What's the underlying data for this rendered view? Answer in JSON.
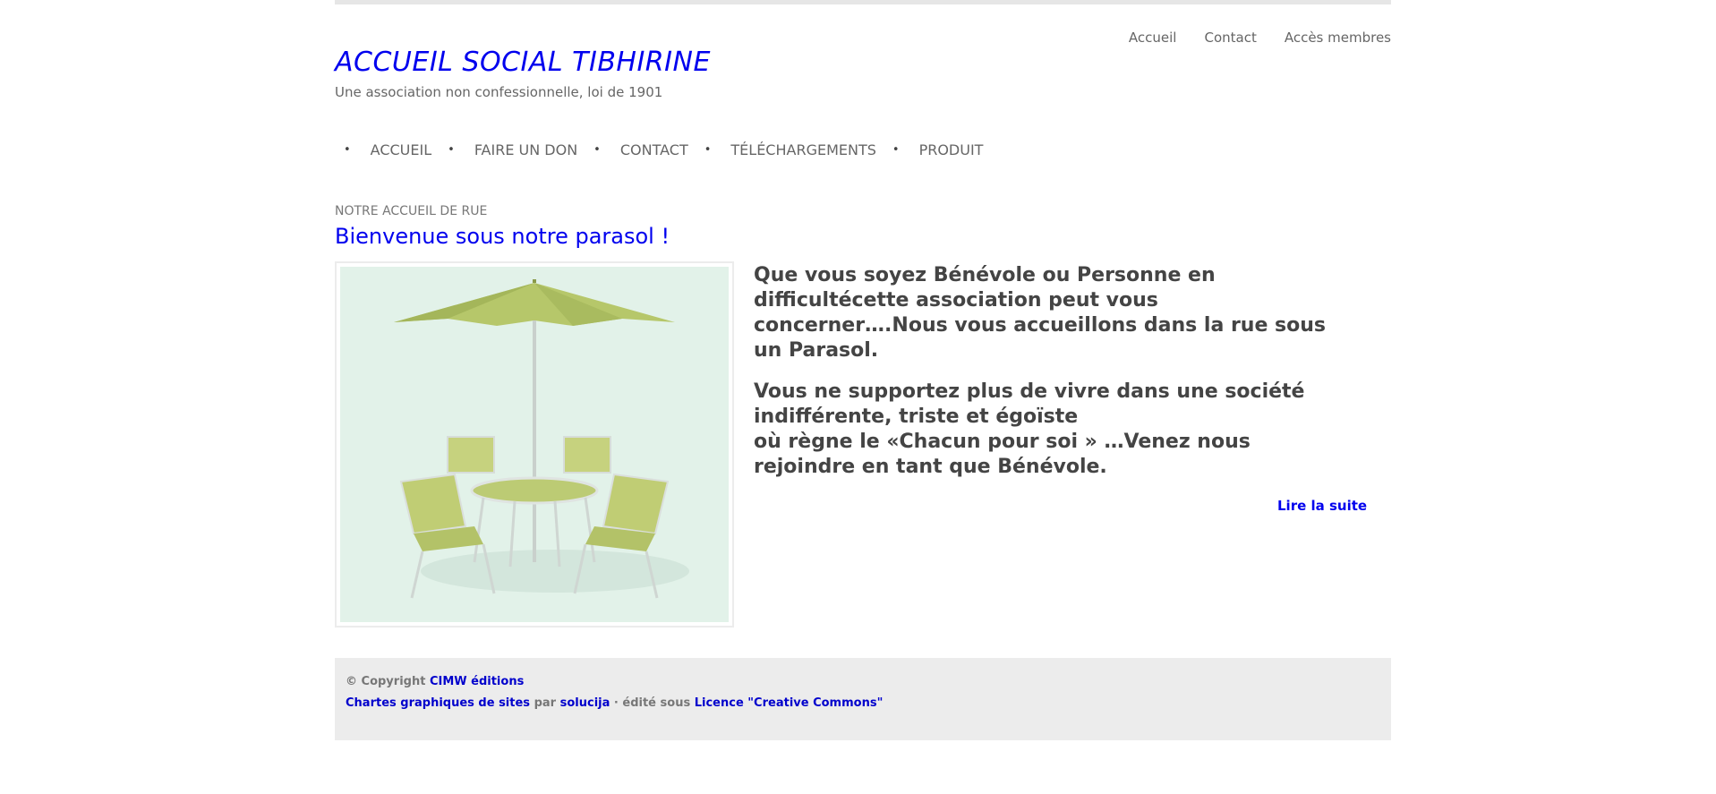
{
  "top_links": [
    "Accueil",
    "Contact",
    "Accès membres"
  ],
  "site": {
    "title": "ACCUEIL SOCIAL TIBHIRINE",
    "description": "Une association non confessionnelle, loi de 1901"
  },
  "nav": {
    "bullet": "•",
    "items": [
      "ACCUEIL",
      "FAIRE UN DON",
      "CONTACT",
      "TÉLÉCHARGEMENTS",
      "PRODUIT"
    ]
  },
  "article": {
    "section_label": "NOTRE ACCUEIL DE RUE",
    "title": "Bienvenue sous notre parasol !",
    "paragraph1": "Que vous soyez Bénévole ou Personne en difficultécette association peut vous concerner….Nous vous accueillons dans la rue sous un Parasol.",
    "paragraph2_line1": "Vous ne supportez plus de vivre dans une société indifférente, triste et égoïste",
    "paragraph2_line2": "où règne le «Chacun pour soi » …Venez nous rejoindre en tant que Bénévole.",
    "read_more": "Lire la suite",
    "image_icon": "parasol-table-chairs-photo"
  },
  "footer": {
    "copyright_prefix": "© Copyright",
    "copyright_link": "CIMW éditions",
    "themes_link": "Chartes graphiques de sites",
    "by_text": "par",
    "author_link": "solucija",
    "edited_text": "· édité sous",
    "license_link": "Licence \"Creative Commons\""
  },
  "colors": {
    "link_blue": "#0000ee",
    "text_gray": "#666666",
    "footer_bg": "#ececec",
    "photo_bg": "#e2f2e9",
    "parasol_green": "#b6c76a"
  }
}
